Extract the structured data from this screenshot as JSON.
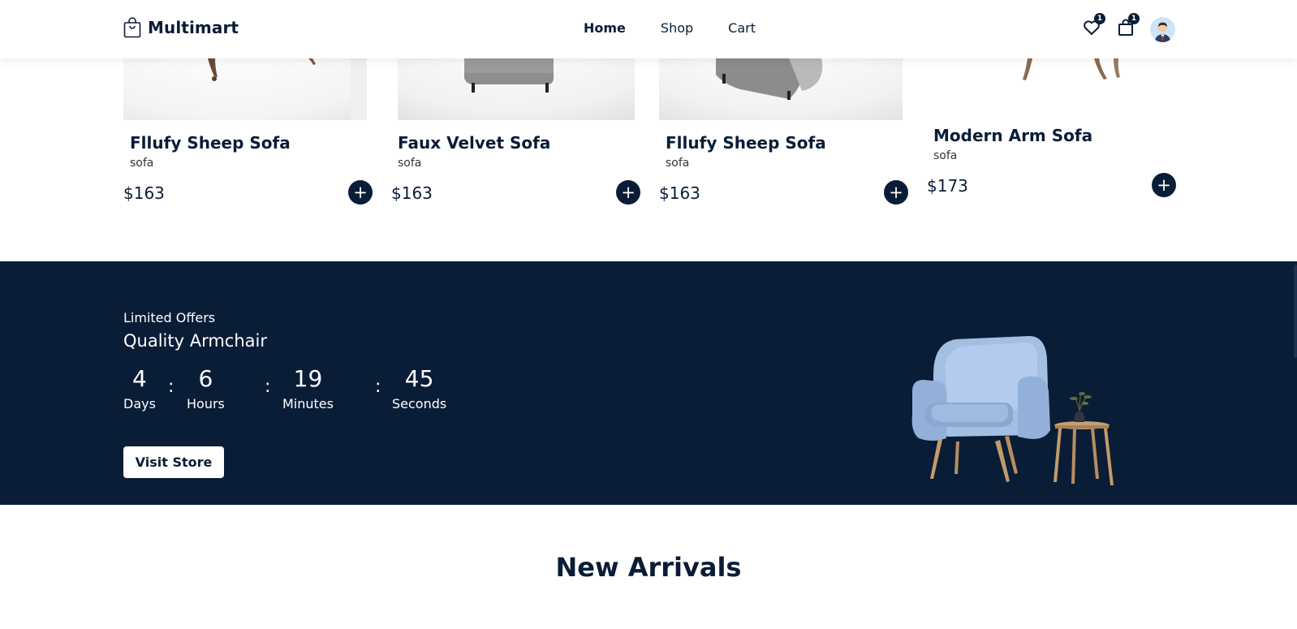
{
  "brand": {
    "name": "Multimart",
    "logo_icon": "shopping-bag-icon"
  },
  "nav": [
    {
      "label": "Home",
      "active": true
    },
    {
      "label": "Shop",
      "active": false
    },
    {
      "label": "Cart",
      "active": false
    }
  ],
  "header_actions": {
    "wishlist": {
      "icon": "heart-icon",
      "count": "1"
    },
    "cart": {
      "icon": "shopping-bag-icon",
      "count": "1"
    },
    "profile": {
      "icon": "user-avatar"
    }
  },
  "products": [
    {
      "name": "Fllufy Sheep Sofa",
      "category": "sofa",
      "price": "$163",
      "add_icon": "plus-icon"
    },
    {
      "name": "Faux Velvet Sofa",
      "category": "sofa",
      "price": "$163",
      "add_icon": "plus-icon"
    },
    {
      "name": "Fllufy Sheep Sofa",
      "category": "sofa",
      "price": "$163",
      "add_icon": "plus-icon"
    },
    {
      "name": "Modern Arm Sofa",
      "category": "sofa",
      "price": "$173",
      "add_icon": "plus-icon"
    }
  ],
  "offer": {
    "subtitle": "Limited Offers",
    "title": "Quality Armchair",
    "countdown": [
      {
        "value": "4",
        "label": "Days"
      },
      {
        "value": "6",
        "label": "Hours"
      },
      {
        "value": "19",
        "label": "Minutes"
      },
      {
        "value": "45",
        "label": "Seconds"
      }
    ],
    "separator": ":",
    "button_label": "Visit Store"
  },
  "new_arrivals": {
    "title": "New Arrivals"
  },
  "colors": {
    "primary": "#0a1d37",
    "background": "#ffffff",
    "chair": "#a3bfe2"
  }
}
